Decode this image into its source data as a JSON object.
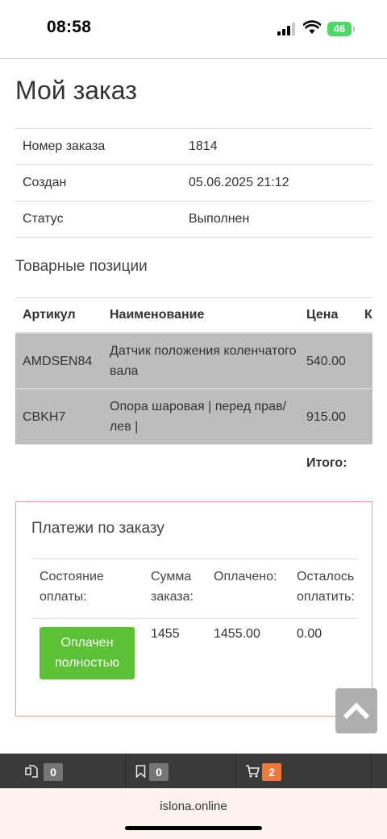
{
  "status_bar": {
    "time": "08:58",
    "battery": "46"
  },
  "page": {
    "title": "Мой заказ"
  },
  "order_info": [
    {
      "label": "Номер заказа",
      "value": "1814"
    },
    {
      "label": "Создан",
      "value": "05.06.2025 21:12"
    },
    {
      "label": "Статус",
      "value": "Выполнен"
    }
  ],
  "items_section": {
    "title": "Товарные позиции",
    "headers": {
      "sku": "Артикул",
      "name": "Наименование",
      "price": "Цена",
      "qty": "К"
    },
    "rows": [
      {
        "sku": "AMDSEN84",
        "name": "Датчик положения коленчатого вала",
        "price": "540.00"
      },
      {
        "sku": "CBKH7",
        "name": "Опора шаровая | перед прав/лев |",
        "price": "915.00"
      }
    ],
    "total_label": "Итого:"
  },
  "payments": {
    "title": "Платежи по заказу",
    "headers": {
      "state": "Состояние оплаты:",
      "sum": "Сумма заказа:",
      "paid": "Оплачено:",
      "left": "Осталось оплатить:"
    },
    "row": {
      "state": "Оплачен полностью",
      "sum": "1455",
      "paid": "1455.00",
      "left": "0.00"
    }
  },
  "bottom_bar": {
    "compare_count": "0",
    "bookmarks_count": "0",
    "cart_count": "2"
  },
  "browser": {
    "url": "islona.online"
  },
  "colors": {
    "paid_badge": "#5bc236",
    "payments_border": "#f0a08a",
    "cart_badge": "#f0783c",
    "table_row_bg": "#bdbdbd"
  }
}
